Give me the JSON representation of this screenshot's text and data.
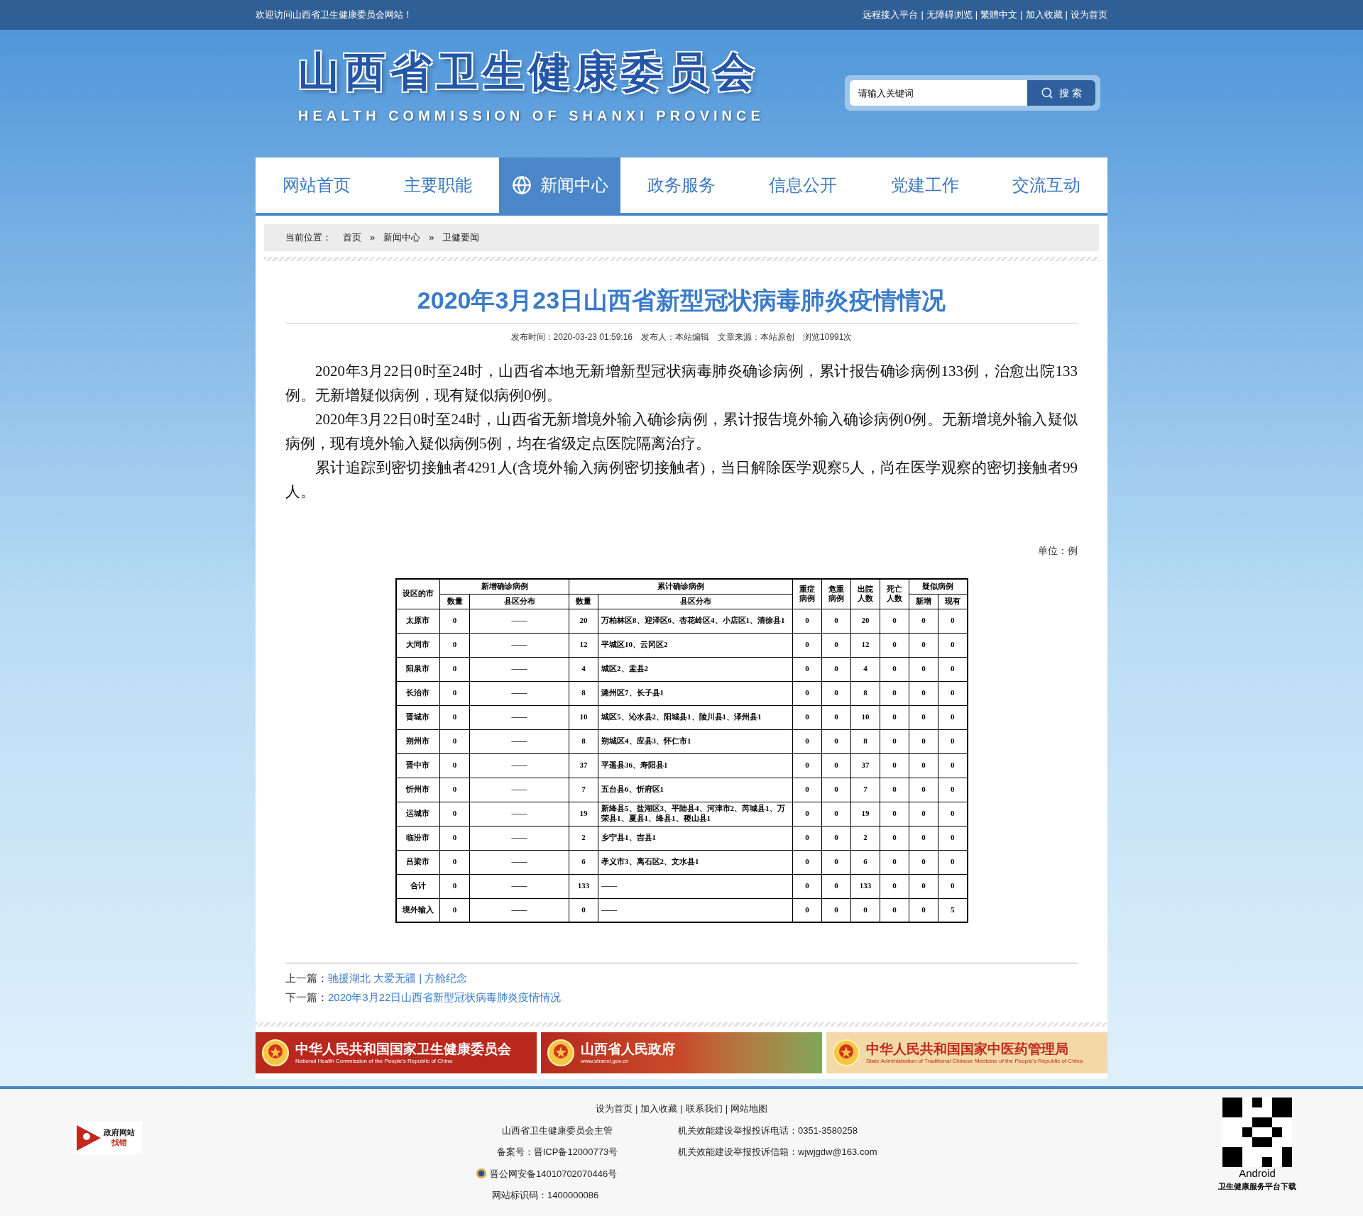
{
  "top_bar": {
    "welcome": "欢迎访问山西省卫生健康委员会网站！",
    "separator": "|",
    "links": [
      "远程接入平台",
      "无障碍浏览",
      "繁體中文",
      "加入收藏",
      "设为首页"
    ]
  },
  "header": {
    "title": "山西省卫生健康委员会",
    "subtitle": "HEALTH COMMISSION OF SHANXI PROVINCE",
    "search": {
      "placeholder": "请输入关键词",
      "button": "搜 索"
    }
  },
  "nav": [
    {
      "label": "网站首页",
      "selected": false
    },
    {
      "label": "主要职能",
      "selected": false
    },
    {
      "label": "新闻中心",
      "selected": true
    },
    {
      "label": "政务服务",
      "selected": false
    },
    {
      "label": "信息公开",
      "selected": false
    },
    {
      "label": "党建工作",
      "selected": false
    },
    {
      "label": "交流互动",
      "selected": false
    }
  ],
  "breadcrumb": {
    "label": "当前位置：",
    "separator": "»",
    "items": [
      "首页",
      "新闻中心",
      "卫健要闻"
    ]
  },
  "article": {
    "title": "2020年3月23日山西省新型冠状病毒肺炎疫情情况",
    "meta": [
      "发布时间：2020-03-23 01:59:16",
      "发布人：本站编辑",
      "文章来源：本站原创",
      "浏览10991次"
    ],
    "paragraphs": [
      "2020年3月22日0时至24时，山西省本地无新增新型冠状病毒肺炎确诊病例，累计报告确诊病例133例，治愈出院133例。无新增疑似病例，现有疑似病例0例。",
      "2020年3月22日0时至24时，山西省无新增境外输入确诊病例，累计报告境外输入确诊病例0例。无新增境外输入疑似病例，现有境外输入疑似病例5例，均在省级定点医院隔离治疗。",
      "累计追踪到密切接触者4291人(含境外输入病例密切接触者)，当日解除医学观察5人，尚在医学观察的密切接触者99人。"
    ],
    "unit": "单位：例",
    "table": {
      "header_rows": [
        [
          {
            "text": "设区的市",
            "rowspan": 2
          },
          {
            "text": "新增确诊病例",
            "colspan": 2
          },
          {
            "text": "累计确诊病例",
            "colspan": 2
          },
          {
            "text": "重症病例",
            "rowspan": 2
          },
          {
            "text": "危重病例",
            "rowspan": 2
          },
          {
            "text": "出院人数",
            "rowspan": 2
          },
          {
            "text": "死亡人数",
            "rowspan": 2
          },
          {
            "text": "疑似病例",
            "colspan": 2
          }
        ],
        [
          {
            "text": "数量"
          },
          {
            "text": "县区分布"
          },
          {
            "text": "数量"
          },
          {
            "text": "县区分布"
          },
          {
            "text": "新增"
          },
          {
            "text": "现有"
          }
        ]
      ],
      "rows": [
        [
          "太原市",
          "0",
          "——",
          "20",
          "万柏林区8、迎泽区6、杏花岭区4、小店区1、清徐县1",
          "0",
          "0",
          "20",
          "0",
          "0",
          "0"
        ],
        [
          "大同市",
          "0",
          "——",
          "12",
          "平城区10、云冈区2",
          "0",
          "0",
          "12",
          "0",
          "0",
          "0"
        ],
        [
          "阳泉市",
          "0",
          "——",
          "4",
          "城区2、盂县2",
          "0",
          "0",
          "4",
          "0",
          "0",
          "0"
        ],
        [
          "长治市",
          "0",
          "——",
          "8",
          "潞州区7、长子县1",
          "0",
          "0",
          "8",
          "0",
          "0",
          "0"
        ],
        [
          "晋城市",
          "0",
          "——",
          "10",
          "城区5、沁水县2、阳城县1、陵川县1、泽州县1",
          "0",
          "0",
          "10",
          "0",
          "0",
          "0"
        ],
        [
          "朔州市",
          "0",
          "——",
          "8",
          "朔城区4、应县3、怀仁市1",
          "0",
          "0",
          "8",
          "0",
          "0",
          "0"
        ],
        [
          "晋中市",
          "0",
          "——",
          "37",
          "平遥县36、寿阳县1",
          "0",
          "0",
          "37",
          "0",
          "0",
          "0"
        ],
        [
          "忻州市",
          "0",
          "——",
          "7",
          "五台县6、忻府区1",
          "0",
          "0",
          "7",
          "0",
          "0",
          "0"
        ],
        [
          "运城市",
          "0",
          "——",
          "19",
          "新绛县5、盐湖区3、平陆县4、河津市2、芮城县1、万荣县1、夏县1、绛县1、稷山县1",
          "0",
          "0",
          "19",
          "0",
          "0",
          "0"
        ],
        [
          "临汾市",
          "0",
          "——",
          "2",
          "乡宁县1、吉县1",
          "0",
          "0",
          "2",
          "0",
          "0",
          "0"
        ],
        [
          "吕梁市",
          "0",
          "——",
          "6",
          "孝义市3、离石区2、文水县1",
          "0",
          "0",
          "6",
          "0",
          "0",
          "0"
        ],
        [
          "合计",
          "0",
          "——",
          "133",
          "——",
          "0",
          "0",
          "133",
          "0",
          "0",
          "0"
        ],
        [
          "境外输入",
          "0",
          "——",
          "0",
          "——",
          "0",
          "0",
          "0",
          "0",
          "0",
          "5"
        ]
      ]
    },
    "pager": [
      {
        "label": "上一篇：",
        "title": "驰援湖北 大爱无疆 | 方舱纪念"
      },
      {
        "label": "下一篇：",
        "title": "2020年3月22日山西省新型冠状病毒肺炎疫情情况"
      }
    ]
  },
  "banners": [
    {
      "title": "中华人民共和国国家卫生健康委员会",
      "subtitle": "National Health Commission of the People's Republic of China"
    },
    {
      "title": "山西省人民政府",
      "subtitle": "www.shanxi.gov.cn"
    },
    {
      "title": "中华人民共和国国家中医药管理局",
      "subtitle": "State Administration of Traditional Chinese Medicine of the People's Republic of China"
    }
  ],
  "footer": {
    "badge": [
      "政府网站",
      "找错"
    ],
    "separator": "|",
    "links": [
      "设为首页",
      "加入收藏",
      "联系我们",
      "网站地图"
    ],
    "lines": [
      [
        "山西省卫生健康委员会主管",
        "机关效能建设举报投诉电话：0351-3580258"
      ],
      [
        "备案号：晋ICP备12000773号",
        "机关效能建设举报投诉信箱：wjwjgdw@163.com"
      ]
    ],
    "police": "晋公网安备14010702070446号",
    "site_code": "网站标识码：1400000086",
    "qr": {
      "title": "Android",
      "caption": "卫生健康服务平台下载"
    }
  }
}
